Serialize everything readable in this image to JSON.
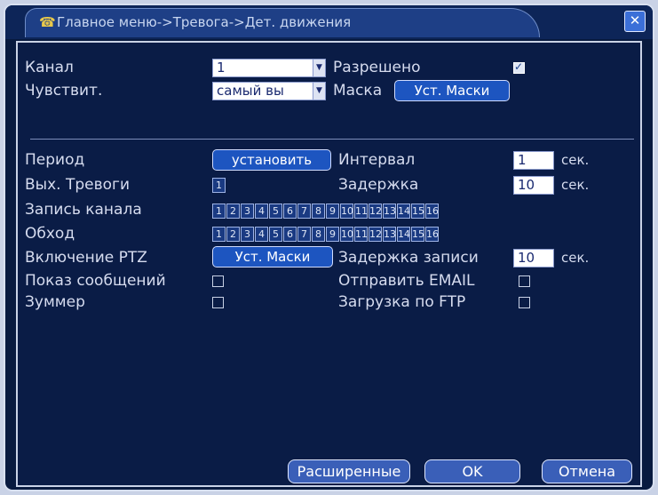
{
  "window": {
    "title": "Главное меню->Тревога->Дет. движения",
    "title_icon": "alarm-icon",
    "close_icon": "close-icon"
  },
  "channel": {
    "label": "Канал",
    "value": "1"
  },
  "enabled": {
    "label": "Разрешено",
    "checked": true
  },
  "sensitivity": {
    "label": "Чувствит.",
    "value": "самый вы"
  },
  "mask": {
    "label": "Маска",
    "button": "Уст. Маски"
  },
  "period": {
    "label": "Период",
    "button": "установить"
  },
  "interval": {
    "label": "Интервал",
    "value": "1",
    "unit": "сек."
  },
  "alarm_out": {
    "label": "Вых. Тревоги",
    "value": "1"
  },
  "delay": {
    "label": "Задержка",
    "value": "10",
    "unit": "сек."
  },
  "record_channel": {
    "label": "Запись канала",
    "cells": [
      "1",
      "2",
      "3",
      "4",
      "5",
      "6",
      "7",
      "8",
      "9",
      "10",
      "11",
      "12",
      "13",
      "14",
      "15",
      "16"
    ]
  },
  "tour": {
    "label": "Обход",
    "cells": [
      "1",
      "2",
      "3",
      "4",
      "5",
      "6",
      "7",
      "8",
      "9",
      "10",
      "11",
      "12",
      "13",
      "14",
      "15",
      "16"
    ]
  },
  "ptz": {
    "label": "Включение PTZ",
    "button": "Уст. Маски"
  },
  "record_delay": {
    "label": "Задержка записи",
    "value": "10",
    "unit": "сек."
  },
  "show_message": {
    "label": "Показ сообщений",
    "checked": false
  },
  "send_email": {
    "label": "Отправить EMAIL",
    "checked": false
  },
  "buzzer": {
    "label": "Зуммер",
    "checked": false
  },
  "ftp_upload": {
    "label": "Загрузка по FTP",
    "checked": false
  },
  "footer": {
    "advanced": "Расширенные",
    "ok": "OK",
    "cancel": "Отмена"
  }
}
